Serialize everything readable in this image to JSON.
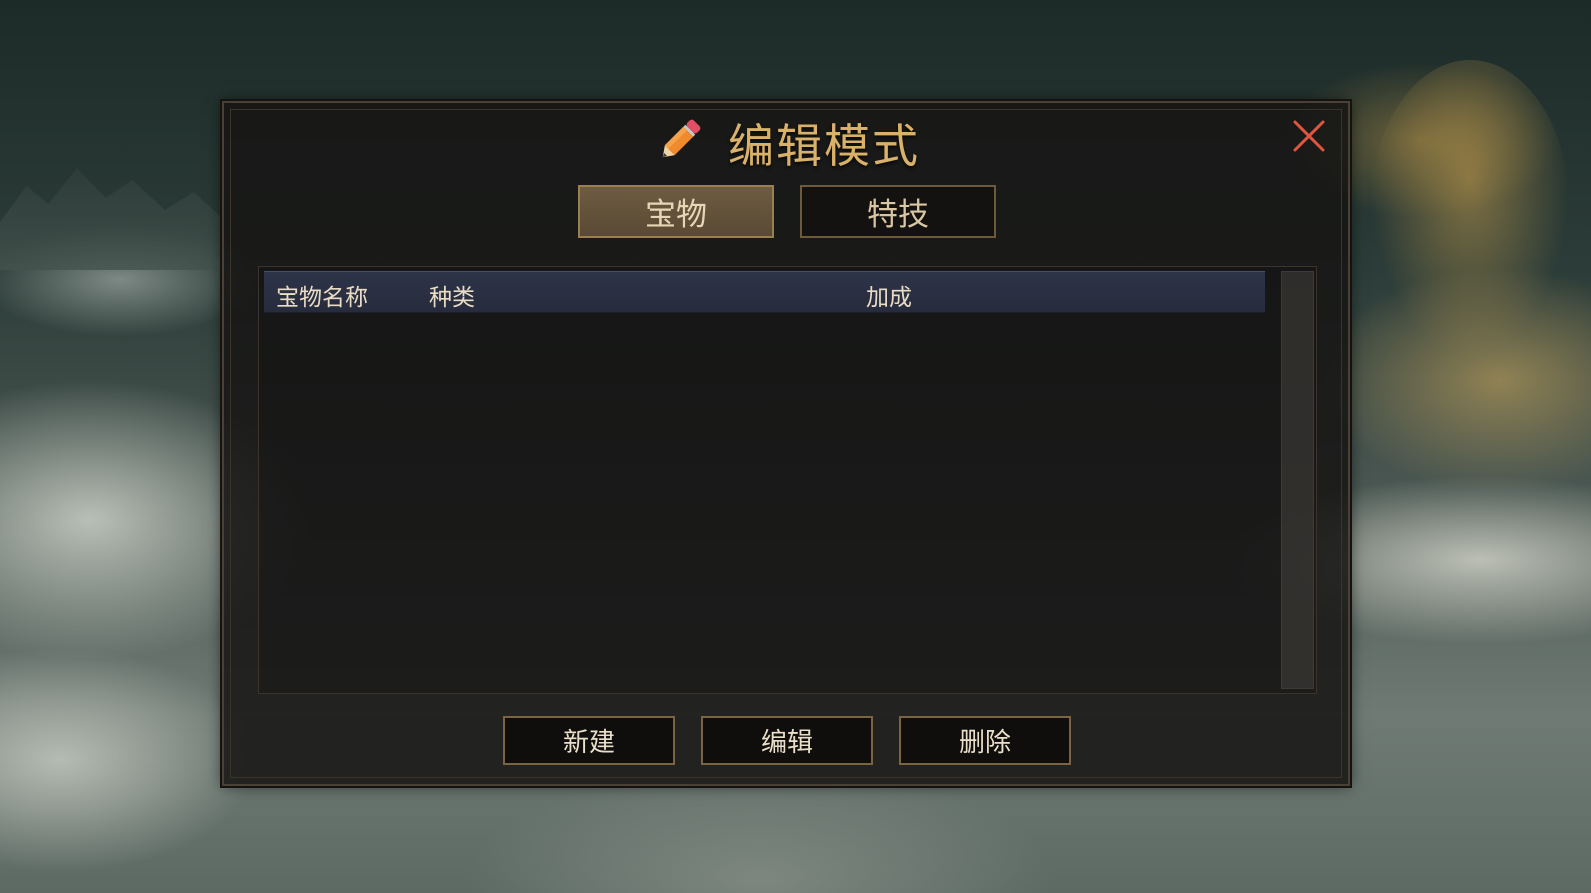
{
  "dialog": {
    "title": "编辑模式",
    "tabs": [
      {
        "label": "宝物",
        "active": true
      },
      {
        "label": "特技",
        "active": false
      }
    ],
    "table": {
      "columns": [
        "宝物名称",
        "种类",
        "加成"
      ],
      "rows": []
    },
    "buttons": {
      "new_label": "新建",
      "edit_label": "编辑",
      "delete_label": "删除"
    }
  },
  "icons": {
    "title_icon": "pencil-icon",
    "close_icon": "close-icon"
  },
  "colors": {
    "title": "#d9b16a",
    "close": "#e0553f",
    "tab_active": "#6d5c42",
    "header_bg": "#2e3448",
    "button_border": "#7a6442"
  }
}
